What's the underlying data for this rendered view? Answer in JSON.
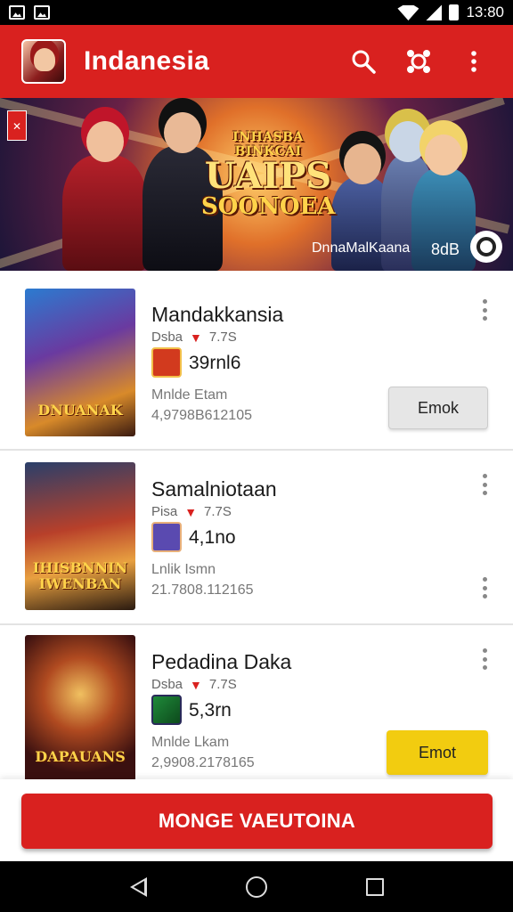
{
  "status_bar": {
    "time": "13:80"
  },
  "app_bar": {
    "title": "Indanesia"
  },
  "banner": {
    "title_line1": "INHASBA BINKCAI",
    "title_line2": "UAIPS",
    "title_line3": "SOONOEA",
    "caption": "DnnaMalKaana",
    "count": "8dB"
  },
  "items": [
    {
      "title": "Mandakkansia",
      "meta_label": "Dsba",
      "meta_value": "7.7S",
      "size": "39rnl6",
      "sub": "Mnlde Etam",
      "date": "4,9798B612105",
      "action": "Emok",
      "thumb_text": "DNUANAK"
    },
    {
      "title": "Samalniotaan",
      "meta_label": "Pisa",
      "meta_value": "7.7S",
      "size": "4,1no",
      "sub": "Lnlik Ismn",
      "date": "21.7808.112165",
      "action": "",
      "thumb_text": "IHISBNNIN IWENBAN"
    },
    {
      "title": "Pedadina Daka",
      "meta_label": "Dsba",
      "meta_value": "7.7S",
      "size": "5,3rn",
      "sub": "Mnlde Lkam",
      "date": "2,9908.2178165",
      "action": "Emot",
      "thumb_text": "DAPAUANS"
    }
  ],
  "cta": {
    "label": "MONGE VAEUTOINA"
  }
}
